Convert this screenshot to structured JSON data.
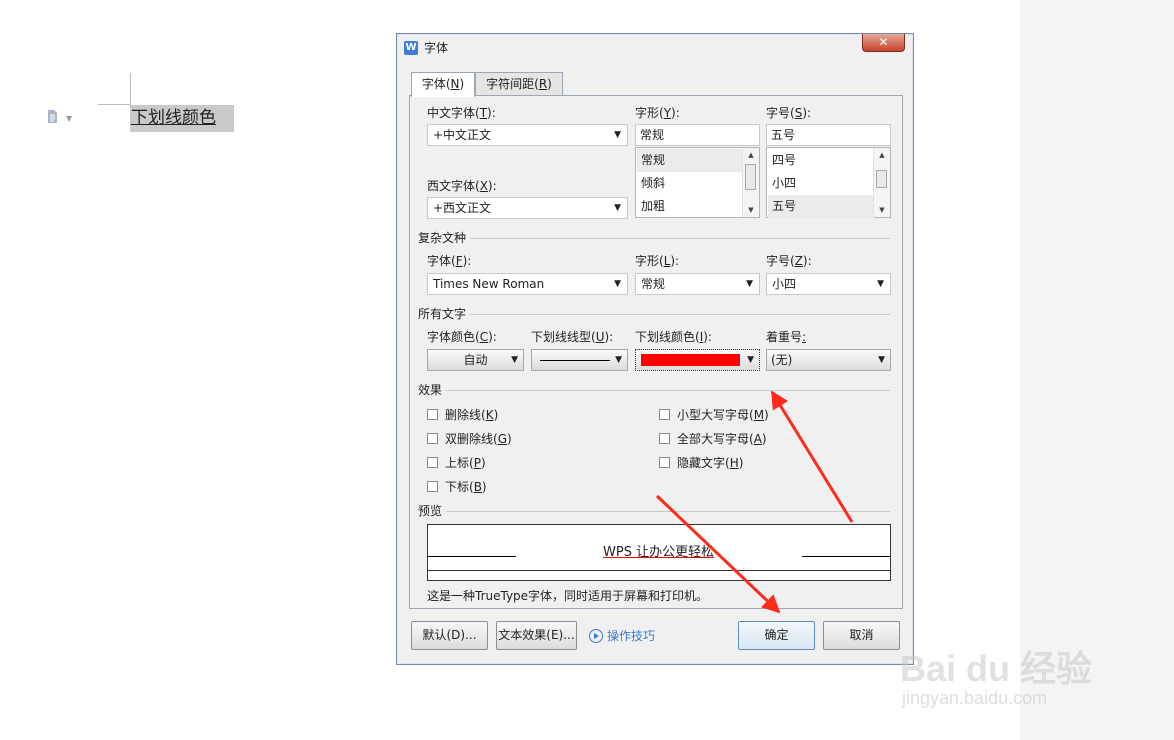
{
  "document": {
    "selected_text": "下划线颜色"
  },
  "dialog": {
    "title": "字体",
    "close_label": "✕",
    "tabs": [
      {
        "label_main": "字体(",
        "label_key": "N",
        "label_end": ")"
      },
      {
        "label_main": "字符间距(",
        "label_key": "R",
        "label_end": ")"
      }
    ],
    "chinese_font": {
      "label": "中文字体(",
      "key": "T",
      "end": "):",
      "value": "+中文正文"
    },
    "style": {
      "label": "字形(",
      "key": "Y",
      "end": "):",
      "value": "常规",
      "options": [
        "常规",
        "倾斜",
        "加粗"
      ]
    },
    "size": {
      "label": "字号(",
      "key": "S",
      "end": "):",
      "value": "五号",
      "options": [
        "四号",
        "小四",
        "五号"
      ]
    },
    "western_font": {
      "label": "西文字体(",
      "key": "X",
      "end": "):",
      "value": "+西文正文"
    },
    "complex": {
      "section_title": "复杂文种",
      "font": {
        "label": "字体(",
        "key": "F",
        "end": "):",
        "value": "Times New Roman"
      },
      "style": {
        "label": "字形(",
        "key": "L",
        "end": "):",
        "value": "常规"
      },
      "size": {
        "label": "字号(",
        "key": "Z",
        "end": "):",
        "value": "小四"
      }
    },
    "all_text": {
      "section_title": "所有文字",
      "font_color": {
        "label": "字体颜色(",
        "key": "C",
        "end": "):",
        "value": "自动"
      },
      "underline_type": {
        "label": "下划线线型(",
        "key": "U",
        "end": "):"
      },
      "underline_color": {
        "label": "下划线颜色(",
        "key": "I",
        "end": "):",
        "color": "#ff0000"
      },
      "emphasis": {
        "label": "着重号",
        "end": ":",
        "value": "(无)"
      }
    },
    "effects": {
      "section_title": "效果",
      "items": [
        {
          "label": "删除线(",
          "key": "K",
          "end": ")"
        },
        {
          "label": "双删除线(",
          "key": "G",
          "end": ")"
        },
        {
          "label": "上标(",
          "key": "P",
          "end": ")"
        },
        {
          "label": "下标(",
          "key": "B",
          "end": ")"
        },
        {
          "label": "小型大写字母(",
          "key": "M",
          "end": ")"
        },
        {
          "label": "全部大写字母(",
          "key": "A",
          "end": ")"
        },
        {
          "label": "隐藏文字(",
          "key": "H",
          "end": ")"
        }
      ]
    },
    "preview": {
      "section_title": "预览",
      "sample_text": "WPS 让办公更轻松",
      "description": "这是一种TrueType字体，同时适用于屏幕和打印机。"
    },
    "buttons": {
      "default": "默认(D)...",
      "text_effects": "文本效果(E)...",
      "tips": "操作技巧",
      "ok": "确定",
      "cancel": "取消"
    }
  },
  "watermark": {
    "main": "Bai du 经验",
    "sub": "jingyan.baidu.com"
  },
  "colors": {
    "annotation_arrow": "#ff2a1a",
    "underline_color": "#ff0000"
  }
}
